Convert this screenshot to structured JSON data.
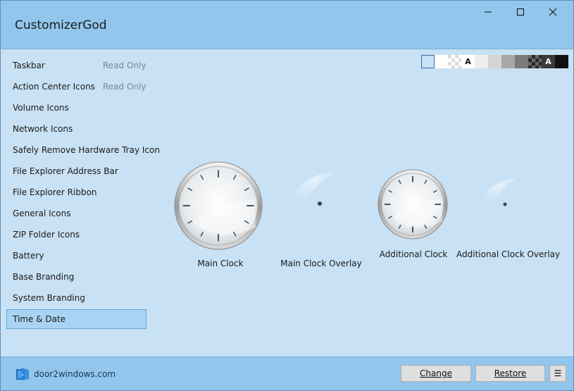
{
  "window": {
    "title": "CustomizerGod"
  },
  "sidebar": {
    "items": [
      {
        "label": "Taskbar",
        "note": "Read Only"
      },
      {
        "label": "Action Center Icons",
        "note": "Read Only"
      },
      {
        "label": "Volume Icons"
      },
      {
        "label": "Network Icons"
      },
      {
        "label": "Safely Remove Hardware Tray Icon"
      },
      {
        "label": "File Explorer Address Bar"
      },
      {
        "label": "File Explorer Ribbon"
      },
      {
        "label": "General Icons"
      },
      {
        "label": "ZIP Folder Icons"
      },
      {
        "label": "Battery"
      },
      {
        "label": "Base Branding"
      },
      {
        "label": "System Branding"
      },
      {
        "label": "Time & Date",
        "selected": true
      }
    ]
  },
  "background_swatches": {
    "selected_index": 0,
    "items": [
      {
        "name": "light-blue",
        "color": "#c8e1f4"
      },
      {
        "name": "white",
        "color": "#ffffff"
      },
      {
        "name": "checker",
        "color": "#ececec"
      },
      {
        "name": "white-text",
        "color": "#ffffff",
        "glyph": "A"
      },
      {
        "name": "very-light-gray",
        "color": "#eeeeee"
      },
      {
        "name": "light-gray",
        "color": "#d4d4d4"
      },
      {
        "name": "gray",
        "color": "#a8a8a8"
      },
      {
        "name": "dark-gray",
        "color": "#7b7b7b"
      },
      {
        "name": "dark-checker",
        "color": "#4a4a4a"
      },
      {
        "name": "dark-text",
        "color": "#3a3a3a",
        "glyph": "A"
      },
      {
        "name": "black",
        "color": "#111111"
      }
    ]
  },
  "resources": [
    {
      "label": "Main Clock",
      "icon": "clock-face-icon"
    },
    {
      "label": "Main Clock Overlay",
      "icon": "clock-overlay-icon"
    },
    {
      "label": "Additional Clock",
      "icon": "clock-face-icon"
    },
    {
      "label": "Additional Clock Overlay",
      "icon": "clock-overlay-icon"
    }
  ],
  "footer": {
    "brand": "door2windows.com",
    "change_label": "Change",
    "restore_label": "Restore",
    "menu_glyph": "☰"
  }
}
